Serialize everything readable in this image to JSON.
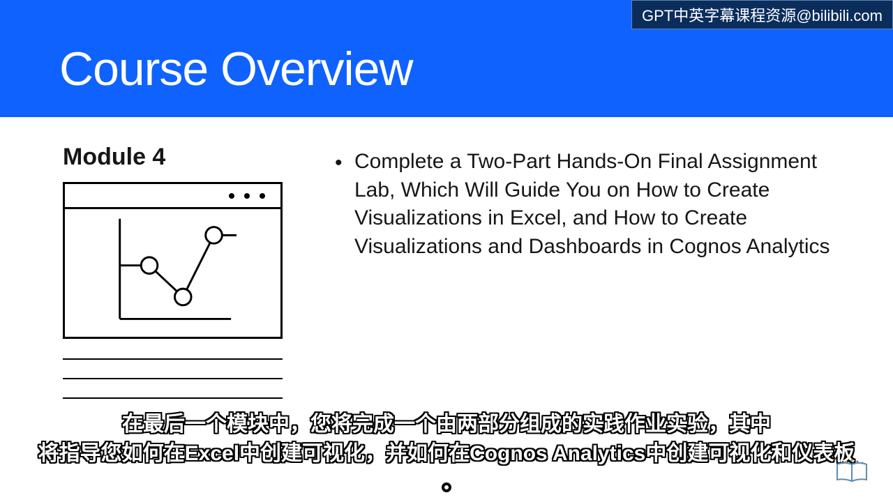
{
  "watermark": "GPT中英字幕课程资源@bilibili.com",
  "title": "Course Overview",
  "module": {
    "heading": "Module 4",
    "bullet1": "Complete a Two-Part Hands-On Final Assignment Lab, Which Will Guide You on How to Create Visualizations in Excel, and How to Create Visualizations and Dashboards in Cognos Analytics"
  },
  "subtitle": {
    "line1": "在最后一个模块中，您将完成一个由两部分组成的实践作业实验，其中",
    "line2": "将指导您如何在Excel中创建可视化，并如何在Cognos Analytics中创建可视化和仪表板"
  }
}
